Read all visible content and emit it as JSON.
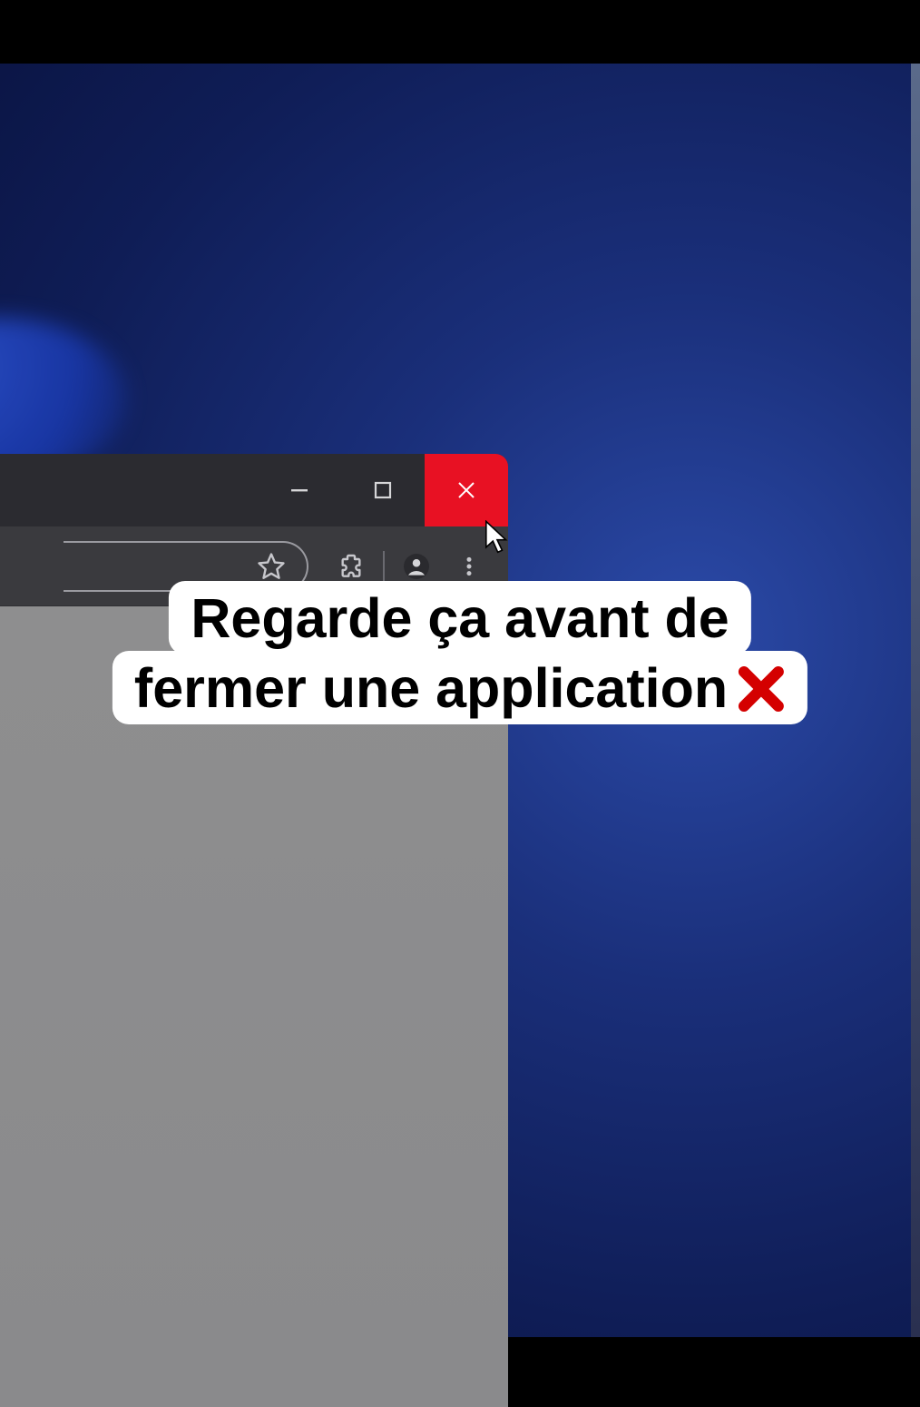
{
  "caption": {
    "line1": "Regarde ça avant de",
    "line2": "fermer une application",
    "emoji": "❌"
  },
  "titlebar": {
    "minimize_label": "Minimize",
    "maximize_label": "Maximize",
    "close_label": "Close"
  },
  "toolbar": {
    "bookmark_label": "Bookmark",
    "extensions_label": "Extensions",
    "profile_label": "Profile",
    "menu_label": "Menu"
  },
  "colors": {
    "close_hover": "#e81123",
    "desktop_bg": "#12276e",
    "titlebar_bg": "#2b2b30",
    "toolbar_bg": "#3a3a3e"
  }
}
